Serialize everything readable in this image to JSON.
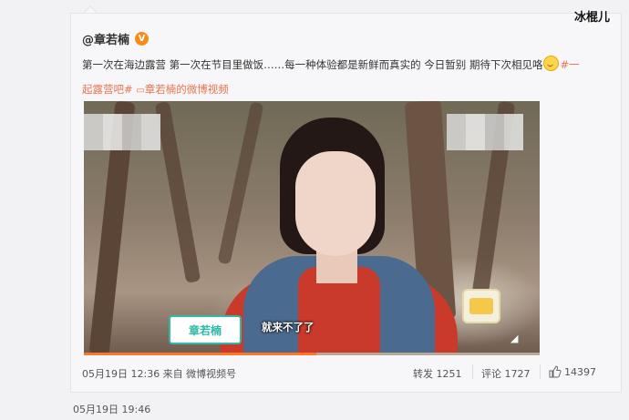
{
  "watermark": "冰棍儿",
  "post": {
    "author": "@章若楠",
    "badge": "V",
    "text_main": "第一次在海边露营 第一次在节目里做饭……每一种体验都是新鲜而真实的 今日暂别 期待下次相见咯",
    "hashtag_a": "#一",
    "hashtag_b": "起露营吧#",
    "video_link": "章若楠的微博视频"
  },
  "video": {
    "name_tag": "章若楠",
    "caption": "就来不了了",
    "progress": 0.51
  },
  "footer": {
    "meta": "05月19日 12:36 来自 微博视频号",
    "repost": "转发 1251",
    "comment": "评论 1727",
    "likes": "14397"
  },
  "bottom_date": "05月19日 19:46",
  "colors": {
    "accent": "#eb7350",
    "progress": "#f77a2a",
    "name_tag": "#2fb9a6",
    "badge": "#f78c1a"
  }
}
